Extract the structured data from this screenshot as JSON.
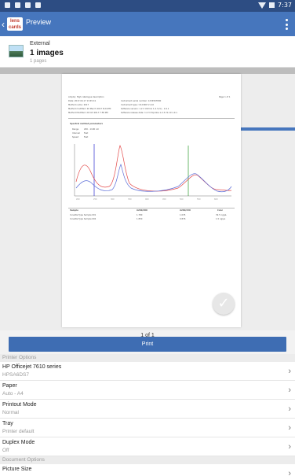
{
  "status_bar": {
    "time": "7:37"
  },
  "app_bar": {
    "logo": "lens\ncards",
    "title": "Preview"
  },
  "source": {
    "label": "External",
    "count": "1 images",
    "pages": "1 pages"
  },
  "page_preview": {
    "header_left": [
      "Ampliq: High catalogue description",
      "Date: 2017.04.17 13:45:41",
      "Method name: 2017",
      "Method modified: 20 March 2017 8:24 PM",
      "Method Modified: 20 Oct 2017 7:58 PM"
    ],
    "header_mid": [
      "Instrument serial number: 1234567890",
      "Instrument type: UV-1800 V1.10",
      "Software version: 1.2.3 UVmini 1.2.3 (V) - 1.6.1",
      "Software release date: 1.2.3 UVprobe 1.2.3 V1.10 1.0.1"
    ],
    "header_right": "Page 1 of 1",
    "params_title": "Spectral method parameters",
    "params": [
      {
        "k": "Range",
        "v": "200 - 1100 nm"
      },
      {
        "k": "Interval",
        "v": "Fast"
      },
      {
        "k": "Speed",
        "v": "Fast"
      }
    ],
    "table_header": [
      "Sample",
      "A260/280",
      "A260/230",
      "Conc"
    ],
    "table_rows": [
      [
        "Cuvette Type Sample 001",
        "1.780",
        "1.035",
        "39.5 ng/µL"
      ],
      [
        "Cuvette Type Sample 002",
        "1.850",
        "0.876",
        "1.5 ng/µL"
      ]
    ],
    "page_label": "1 of 1"
  },
  "print": {
    "label": "Print"
  },
  "printer_options_title": "Printer Options",
  "printer_options": [
    {
      "title": "HP Officejet 7610 series",
      "value": "HPSA6DS7"
    },
    {
      "title": "Paper",
      "value": "Auto - A4"
    },
    {
      "title": "Printout Mode",
      "value": "Normal"
    },
    {
      "title": "Tray",
      "value": "Printer default"
    },
    {
      "title": "Duplex Mode",
      "value": "Off"
    }
  ],
  "document_options_title": "Document Options",
  "document_options": [
    {
      "title": "Picture Size",
      "value": ""
    }
  ],
  "colors": {
    "appbar": "#4676bd",
    "statusbar": "#2d4d83",
    "print_button": "#3e6db3"
  }
}
